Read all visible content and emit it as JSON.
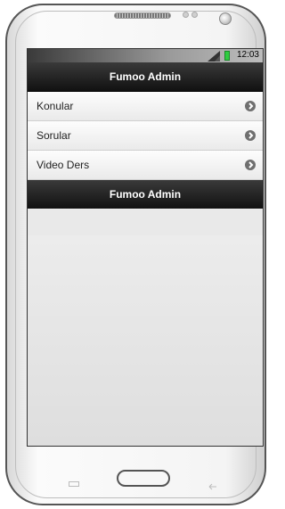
{
  "status_bar": {
    "time": "12:03",
    "battery_icon": "battery-icon",
    "signal_icon": "signal-icon"
  },
  "header": {
    "title": "Fumoo Admin"
  },
  "menu": {
    "items": [
      {
        "label": "Konular",
        "icon": "chevron-right-icon"
      },
      {
        "label": "Sorular",
        "icon": "chevron-right-icon"
      },
      {
        "label": "Video Ders",
        "icon": "chevron-right-icon"
      }
    ]
  },
  "footer": {
    "title": "Fumoo Admin"
  },
  "colors": {
    "bar": "#1a1a1a",
    "list_bg": "#f4f4f4",
    "screen_bg": "#e9e9e9",
    "battery": "#2ecc40"
  }
}
